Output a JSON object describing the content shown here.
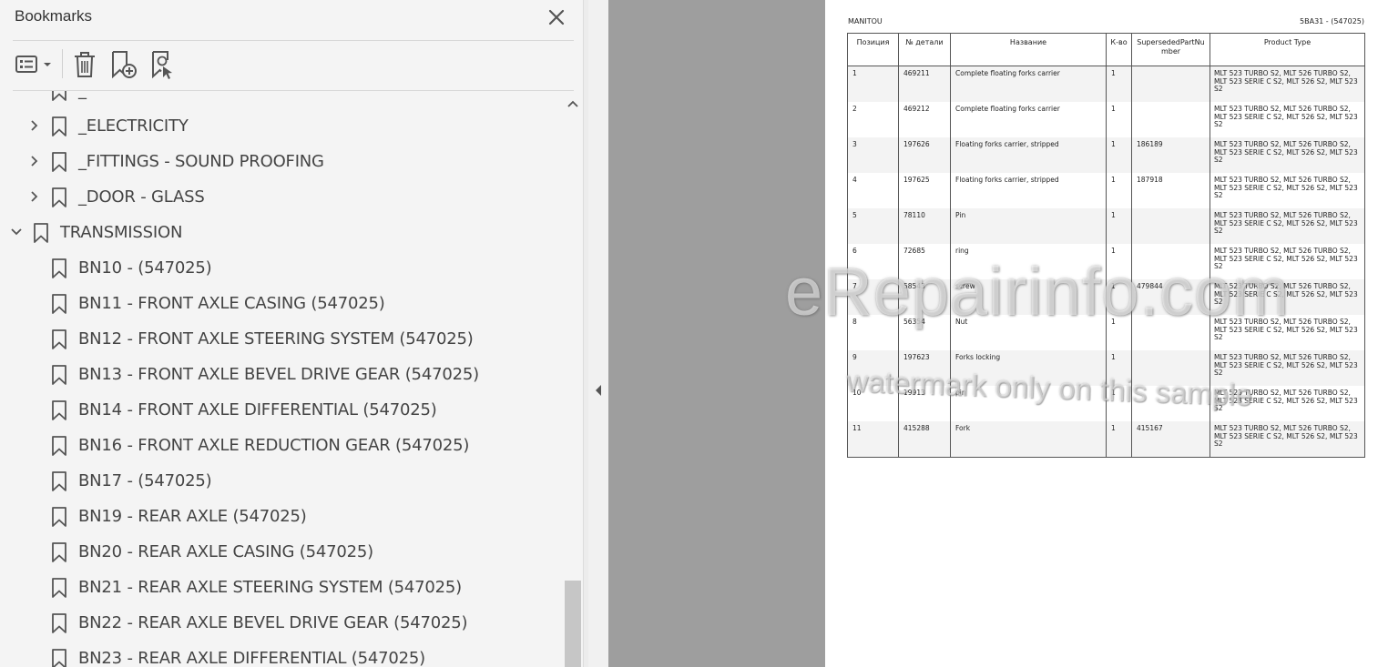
{
  "panel": {
    "title": "Bookmarks"
  },
  "tree": [
    {
      "label": "_",
      "expander": "none",
      "level": 1
    },
    {
      "label": "_ELECTRICITY",
      "expander": "collapsed",
      "level": 1
    },
    {
      "label": "_FITTINGS - SOUND PROOFING",
      "expander": "collapsed",
      "level": 1
    },
    {
      "label": "_DOOR - GLASS",
      "expander": "collapsed",
      "level": 1
    },
    {
      "label": "TRANSMISSION",
      "expander": "expanded",
      "level": 0
    },
    {
      "label": "BN10 - (547025)",
      "expander": "none",
      "level": 1
    },
    {
      "label": "BN11 - FRONT AXLE CASING (547025)",
      "expander": "none",
      "level": 1
    },
    {
      "label": "BN12 - FRONT AXLE STEERING SYSTEM (547025)",
      "expander": "none",
      "level": 1
    },
    {
      "label": "BN13 - FRONT AXLE BEVEL DRIVE GEAR (547025)",
      "expander": "none",
      "level": 1
    },
    {
      "label": "BN14 - FRONT AXLE DIFFERENTIAL (547025)",
      "expander": "none",
      "level": 1
    },
    {
      "label": "BN16 - FRONT AXLE REDUCTION GEAR (547025)",
      "expander": "none",
      "level": 1
    },
    {
      "label": "BN17 - (547025)",
      "expander": "none",
      "level": 1
    },
    {
      "label": "BN19 - REAR AXLE (547025)",
      "expander": "none",
      "level": 1
    },
    {
      "label": "BN20 - REAR AXLE CASING (547025)",
      "expander": "none",
      "level": 1
    },
    {
      "label": "BN21 - REAR AXLE STEERING SYSTEM (547025)",
      "expander": "none",
      "level": 1
    },
    {
      "label": "BN22 - REAR AXLE BEVEL DRIVE GEAR (547025)",
      "expander": "none",
      "level": 1
    },
    {
      "label": "BN23 - REAR AXLE DIFFERENTIAL (547025)",
      "expander": "none",
      "level": 1
    }
  ],
  "document": {
    "brand": "MANITOU",
    "ref": "5BA31 - (547025)",
    "headers": [
      "Позиция",
      "№ детали",
      "Название",
      "К-во",
      "SupersededPartNumber",
      "Product Type"
    ],
    "rows": [
      [
        "1",
        "469211",
        "Complete floating forks carrier",
        "1",
        "",
        "MLT 523 TURBO S2, MLT 526 TURBO S2, MLT 523 SERIE C S2, MLT 526 S2, MLT 523 S2"
      ],
      [
        "2",
        "469212",
        "Complete floating forks carrier",
        "1",
        "",
        "MLT 523 TURBO S2, MLT 526 TURBO S2, MLT 523 SERIE C S2, MLT 526 S2, MLT 523 S2"
      ],
      [
        "3",
        "197626",
        "Floating forks carrier, stripped",
        "1",
        "186189",
        "MLT 523 TURBO S2, MLT 526 TURBO S2, MLT 523 SERIE C S2, MLT 526 S2, MLT 523 S2"
      ],
      [
        "4",
        "197625",
        "Floating forks carrier, stripped",
        "1",
        "187918",
        "MLT 523 TURBO S2, MLT 526 TURBO S2, MLT 523 SERIE C S2, MLT 526 S2, MLT 523 S2"
      ],
      [
        "5",
        "78110",
        "Pin",
        "1",
        "",
        "MLT 523 TURBO S2, MLT 526 TURBO S2, MLT 523 SERIE C S2, MLT 526 S2, MLT 523 S2"
      ],
      [
        "6",
        "72685",
        "ring",
        "1",
        "",
        "MLT 523 TURBO S2, MLT 526 TURBO S2, MLT 523 SERIE C S2, MLT 526 S2, MLT 523 S2"
      ],
      [
        "7",
        "58543",
        "screw",
        "1",
        "479844",
        "MLT 523 TURBO S2, MLT 526 TURBO S2, MLT 523 SERIE C S2, MLT 526 S2, MLT 523 S2"
      ],
      [
        "8",
        "56354",
        "Nut",
        "1",
        "",
        "MLT 523 TURBO S2, MLT 526 TURBO S2, MLT 523 SERIE C S2, MLT 526 S2, MLT 523 S2"
      ],
      [
        "9",
        "197623",
        "Forks locking",
        "1",
        "",
        "MLT 523 TURBO S2, MLT 526 TURBO S2, MLT 523 SERIE C S2, MLT 526 S2, MLT 523 S2"
      ],
      [
        "10",
        "19913",
        "pin",
        "1",
        "",
        "MLT 523 TURBO S2, MLT 526 TURBO S2, MLT 523 SERIE C S2, MLT 526 S2, MLT 523 S2"
      ],
      [
        "11",
        "415288",
        "Fork",
        "1",
        "415167",
        "MLT 523 TURBO S2, MLT 526 TURBO S2, MLT 523 SERIE C S2, MLT 526 S2, MLT 523 S2"
      ]
    ]
  },
  "watermark": {
    "main": "eRepairinfo.com",
    "sub": "watermark only on this sample"
  },
  "colors": {
    "sidebar_bg": "#f4f4f4",
    "viewer_bg": "#9e9e9e",
    "icon_gray": "#555555",
    "text": "#444444"
  },
  "icons": {
    "close": "close-icon",
    "options": "list-options-icon",
    "delete": "trash-icon",
    "new_bookmark": "new-bookmark-icon",
    "find_bookmark": "find-current-bookmark-icon",
    "bookmark": "bookmark-icon"
  }
}
